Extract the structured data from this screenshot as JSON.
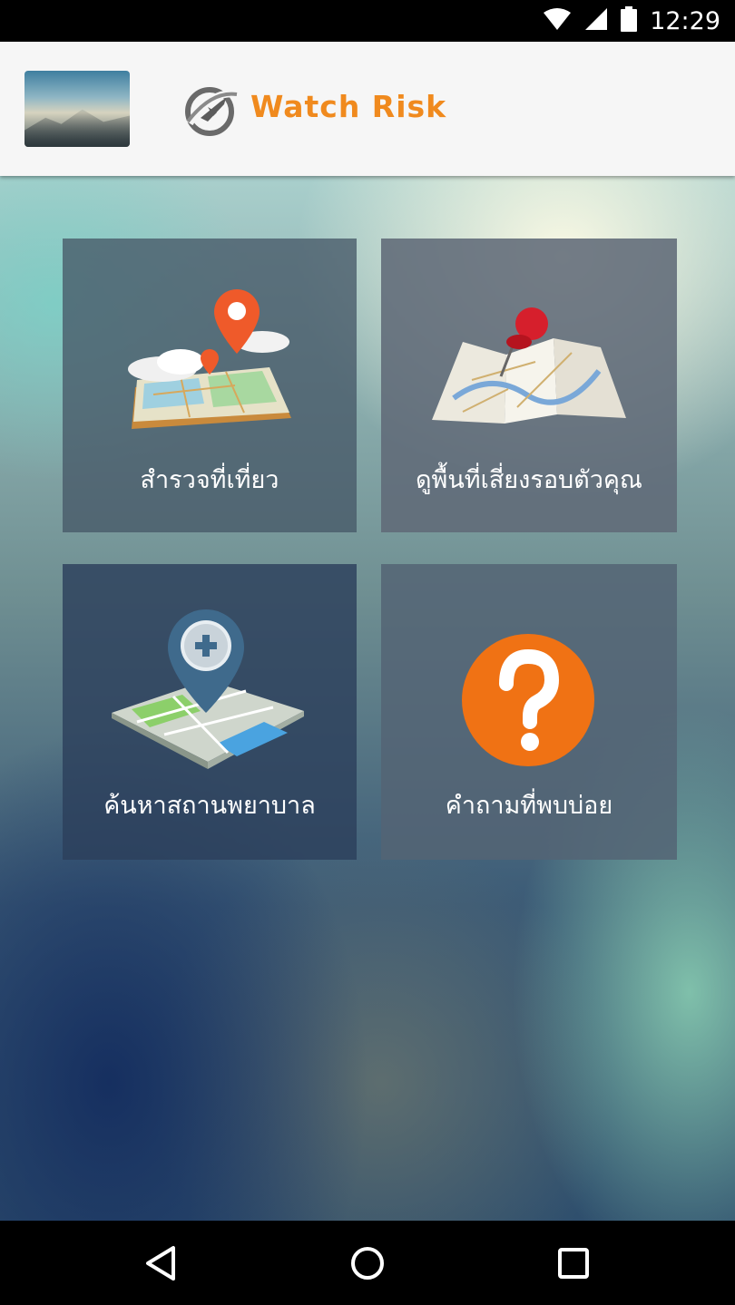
{
  "status_bar": {
    "time": "12:29",
    "icons": [
      "wifi-icon",
      "cellular-signal-icon",
      "battery-icon"
    ]
  },
  "app_bar": {
    "thumbnail": "mountain-fog-image",
    "logo_icon": "plane-globe-logo-icon",
    "title": "Watch Risk"
  },
  "tiles": [
    {
      "label": "สำรวจที่เที่ยว",
      "icon": "map-pins-clouds-icon"
    },
    {
      "label": "ดูพื้นที่เสี่ยงรอบตัวคุณ",
      "icon": "folded-map-pushpin-icon"
    },
    {
      "label": "ค้นหาสถานพยาบาล",
      "icon": "map-medical-pin-icon"
    },
    {
      "label": "คำถามที่พบบ่อย",
      "icon": "question-mark-icon"
    }
  ],
  "nav_bar": {
    "buttons": [
      "back-icon",
      "home-icon",
      "recents-icon"
    ]
  },
  "colors": {
    "accent_orange": "#f08a1e",
    "tile_dark": "#364a60",
    "tile_gray": "#5e6a78",
    "question_orange": "#f07214"
  }
}
